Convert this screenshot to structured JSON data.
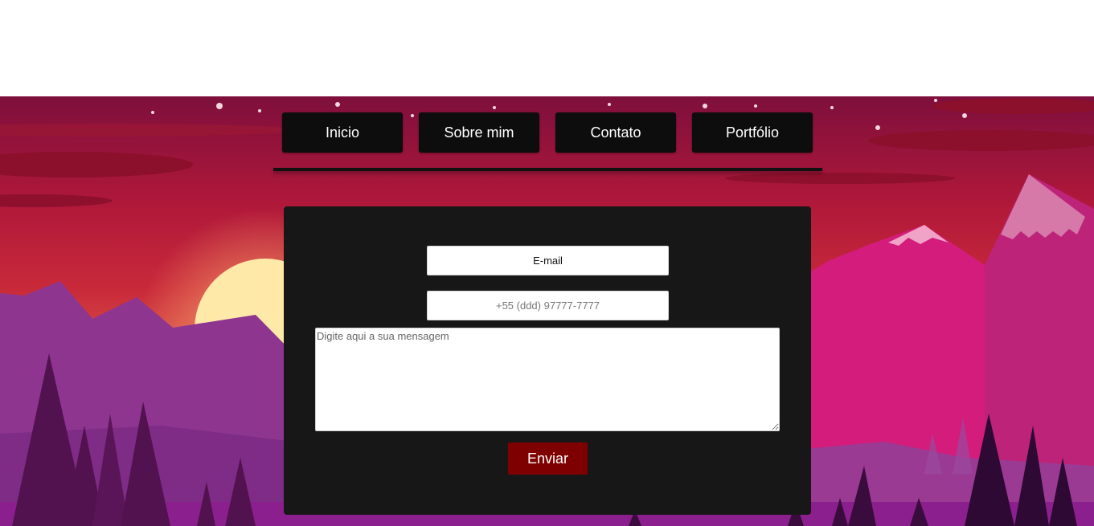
{
  "nav": {
    "items": [
      {
        "label": "Inicio"
      },
      {
        "label": "Sobre mim"
      },
      {
        "label": "Contato"
      },
      {
        "label": "Portfólio"
      }
    ]
  },
  "form": {
    "email_placeholder": "E-mail",
    "phone_placeholder": "+55 (ddd) 97777-7777",
    "message_placeholder": "Digite aqui a sua mensagem",
    "submit_label": "Enviar"
  },
  "colors": {
    "nav_button_bg": "#0d0d0d",
    "panel_bg": "#171717",
    "submit_bg": "#7f0000",
    "sky_top": "#7e0f3c",
    "sky_mid": "#c41e3a",
    "sky_glow": "#e06a4a",
    "sun": "#ffe9a8",
    "mountain_purple": "#8e3590",
    "mountain_pink": "#d41c7c",
    "tree_dark": "#52124f"
  }
}
